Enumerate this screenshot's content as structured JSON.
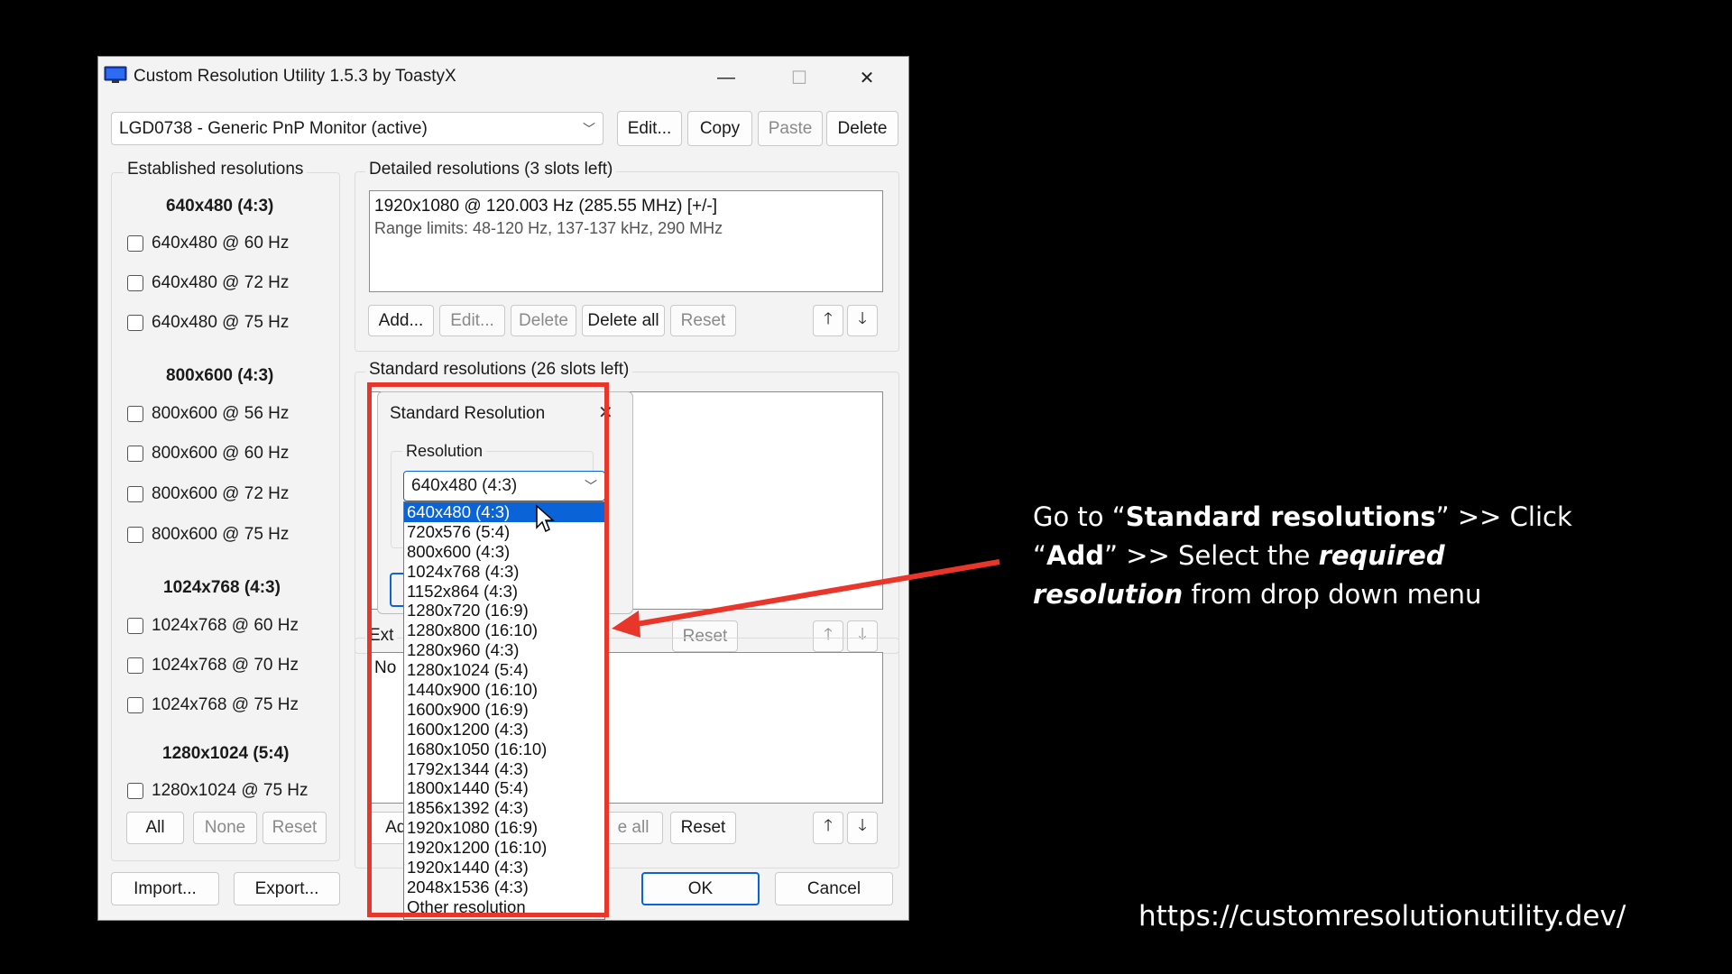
{
  "window": {
    "title": "Custom Resolution Utility 1.5.3 by ToastyX",
    "minimize_glyph": "—",
    "maximize_glyph": "☐",
    "close_glyph": "✕"
  },
  "monitor": {
    "selected": "LGD0738 - Generic PnP Monitor (active)",
    "edit_label": "Edit...",
    "copy_label": "Copy",
    "paste_label": "Paste",
    "delete_label": "Delete"
  },
  "established": {
    "title": "Established resolutions",
    "groups": [
      {
        "heading": "640x480 (4:3)",
        "items": [
          "640x480 @ 60 Hz",
          "640x480 @ 72 Hz",
          "640x480 @ 75 Hz"
        ]
      },
      {
        "heading": "800x600 (4:3)",
        "items": [
          "800x600 @ 56 Hz",
          "800x600 @ 60 Hz",
          "800x600 @ 72 Hz",
          "800x600 @ 75 Hz"
        ]
      },
      {
        "heading": "1024x768 (4:3)",
        "items": [
          "1024x768 @ 60 Hz",
          "1024x768 @ 70 Hz",
          "1024x768 @ 75 Hz"
        ]
      },
      {
        "heading": "1280x1024 (5:4)",
        "items": [
          "1280x1024 @ 75 Hz"
        ]
      }
    ],
    "all_label": "All",
    "none_label": "None",
    "reset_label": "Reset"
  },
  "detailed": {
    "title": "Detailed resolutions (3 slots left)",
    "lines": [
      "1920x1080 @ 120.003 Hz (285.55 MHz) [+/-]",
      "Range limits: 48-120 Hz, 137-137 kHz, 290 MHz"
    ],
    "add_label": "Add...",
    "edit_label": "Edit...",
    "delete_label": "Delete",
    "delete_all_label": "Delete all",
    "reset_label": "Reset",
    "up_glyph": "🡑",
    "down_glyph": "🡓"
  },
  "standard": {
    "title": "Standard resolutions (26 slots left)",
    "reset_label": "Reset"
  },
  "extension": {
    "title_fragment": "Ext",
    "content_fragment": "No",
    "add_fragment": "Add",
    "delete_all_fragment": "e all",
    "reset_label": "Reset"
  },
  "footer": {
    "import_label": "Import...",
    "export_label": "Export...",
    "ok_label": "OK",
    "cancel_label": "Cancel"
  },
  "dialog": {
    "title": "Standard Resolution",
    "close_glyph": "✕",
    "group_label": "Resolution",
    "selected": "640x480 (4:3)",
    "options": [
      "640x480 (4:3)",
      "720x576 (5:4)",
      "800x600 (4:3)",
      "1024x768 (4:3)",
      "1152x864 (4:3)",
      "1280x720 (16:9)",
      "1280x800 (16:10)",
      "1280x960 (4:3)",
      "1280x1024 (5:4)",
      "1440x900 (16:10)",
      "1600x900 (16:9)",
      "1600x1200 (4:3)",
      "1680x1050 (16:10)",
      "1792x1344 (4:3)",
      "1800x1440 (5:4)",
      "1856x1392 (4:3)",
      "1920x1080 (16:9)",
      "1920x1200 (16:10)",
      "1920x1440 (4:3)",
      "2048x1536 (4:3)",
      "Other resolution"
    ],
    "highlighted_index": 0
  },
  "annotation": {
    "p1": "Go to “",
    "b1": "Standard resolutions",
    "p2": "” >> Click “",
    "b2": "Add",
    "p3": "” >> Select the ",
    "bi1": "required resolution",
    "p4": " from drop down menu"
  },
  "url": "https://customresolutionutility.dev/",
  "colors": {
    "highlight": "#0a64d8",
    "annotation_red": "#e8362b",
    "background": "#000000"
  }
}
